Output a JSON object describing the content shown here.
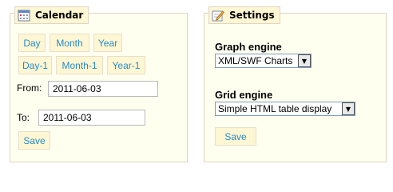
{
  "calendar": {
    "title": "Calendar",
    "icon": "calendar-icon",
    "buttons": {
      "day": "Day",
      "month": "Month",
      "year": "Year",
      "day_minus_1": "Day-1",
      "month_minus_1": "Month-1",
      "year_minus_1": "Year-1"
    },
    "from_label": "From:",
    "from_value": "2011-06-03",
    "to_label": "To:",
    "to_value": "2011-06-03",
    "save_label": "Save"
  },
  "settings": {
    "title": "Settings",
    "icon": "settings-pencil-icon",
    "graph_engine_label": "Graph engine",
    "graph_engine_value": "XML/SWF Charts",
    "grid_engine_label": "Grid engine",
    "grid_engine_value": "Simple HTML table display",
    "save_label": "Save"
  },
  "colors": {
    "panel_bg": "#fffff0",
    "panel_border": "#dfd5c3",
    "button_bg": "#fff6d3",
    "button_text": "#268ccd"
  }
}
